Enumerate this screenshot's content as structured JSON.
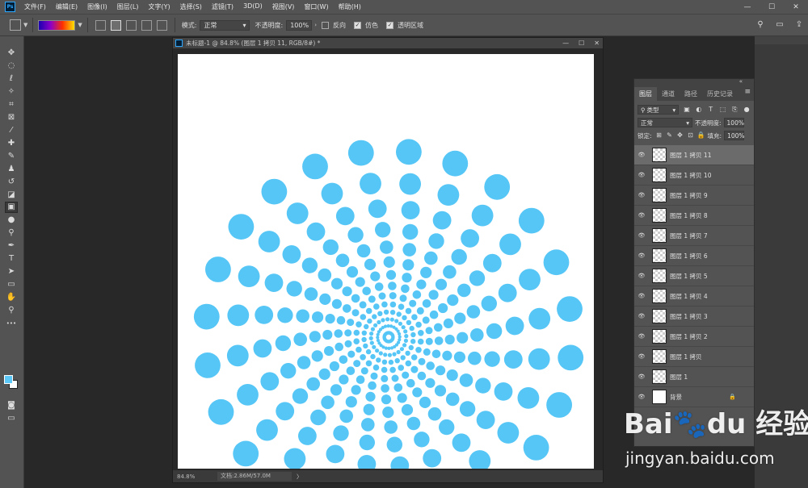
{
  "app": {
    "logo_text": "Ps",
    "menu": [
      "文件(F)",
      "编辑(E)",
      "图像(I)",
      "图层(L)",
      "文字(Y)",
      "选择(S)",
      "滤镜(T)",
      "3D(D)",
      "视图(V)",
      "窗口(W)",
      "帮助(H)"
    ],
    "window_controls": [
      "—",
      "☐",
      "✕"
    ]
  },
  "options_bar": {
    "mode_label": "模式:",
    "mode_value": "正常",
    "opacity_label": "不透明度:",
    "opacity_value": "100%",
    "reverse_label": "反向",
    "dither_label": "仿色",
    "transparency_label": "透明区域",
    "reverse_checked": false,
    "dither_checked": true,
    "transparency_checked": true
  },
  "toolbar": {
    "tools": [
      {
        "name": "move-tool",
        "glyph": "✥"
      },
      {
        "name": "marquee-tool",
        "glyph": "◌"
      },
      {
        "name": "lasso-tool",
        "glyph": "ℓ"
      },
      {
        "name": "magic-wand-tool",
        "glyph": "✧"
      },
      {
        "name": "crop-tool",
        "glyph": "⌗"
      },
      {
        "name": "frame-tool",
        "glyph": "⊠"
      },
      {
        "name": "eyedropper-tool",
        "glyph": "⁄"
      },
      {
        "name": "healing-brush-tool",
        "glyph": "✚"
      },
      {
        "name": "brush-tool",
        "glyph": "✎"
      },
      {
        "name": "clone-stamp-tool",
        "glyph": "♟"
      },
      {
        "name": "history-brush-tool",
        "glyph": "↺"
      },
      {
        "name": "eraser-tool",
        "glyph": "◪"
      },
      {
        "name": "gradient-tool",
        "glyph": "▣"
      },
      {
        "name": "blur-tool",
        "glyph": "●"
      },
      {
        "name": "dodge-tool",
        "glyph": "⚲"
      },
      {
        "name": "pen-tool",
        "glyph": "✒"
      },
      {
        "name": "type-tool",
        "glyph": "T"
      },
      {
        "name": "path-selection-tool",
        "glyph": "➤"
      },
      {
        "name": "rectangle-tool",
        "glyph": "▭"
      },
      {
        "name": "hand-tool",
        "glyph": "✋"
      },
      {
        "name": "zoom-tool",
        "glyph": "⚲"
      },
      {
        "name": "more-tools",
        "glyph": "•••"
      }
    ],
    "active_tool": "gradient-tool",
    "foreground_color": "#5bc8f8",
    "background_color": "#ffffff"
  },
  "document": {
    "title": "未标题-1 @ 84.8% (图层 1 拷贝 11, RGB/8#) *",
    "zoom": "84.8%",
    "doc_info": "文档:2.86M/57.0M",
    "arrow": "〉",
    "dot_color": "#55c6f6"
  },
  "layers_panel": {
    "tabs": [
      "图层",
      "通道",
      "路径",
      "历史记录"
    ],
    "filter_label": "类型",
    "blend_mode": "正常",
    "opacity_label": "不透明度:",
    "opacity_value": "100%",
    "lock_label": "锁定:",
    "fill_label": "填充:",
    "fill_value": "100%",
    "layers": [
      {
        "name": "图层 1 拷贝 11",
        "selected": true,
        "transparent": true
      },
      {
        "name": "图层 1 拷贝 10",
        "selected": false,
        "transparent": true
      },
      {
        "name": "图层 1 拷贝 9",
        "selected": false,
        "transparent": true
      },
      {
        "name": "图层 1 拷贝 8",
        "selected": false,
        "transparent": true
      },
      {
        "name": "图层 1 拷贝 7",
        "selected": false,
        "transparent": true
      },
      {
        "name": "图层 1 拷贝 6",
        "selected": false,
        "transparent": true
      },
      {
        "name": "图层 1 拷贝 5",
        "selected": false,
        "transparent": true
      },
      {
        "name": "图层 1 拷贝 4",
        "selected": false,
        "transparent": true
      },
      {
        "name": "图层 1 拷贝 3",
        "selected": false,
        "transparent": true
      },
      {
        "name": "图层 1 拷贝 2",
        "selected": false,
        "transparent": true
      },
      {
        "name": "图层 1 拷贝",
        "selected": false,
        "transparent": true
      },
      {
        "name": "图层 1",
        "selected": false,
        "transparent": true
      },
      {
        "name": "背景",
        "selected": false,
        "transparent": false,
        "locked": true
      }
    ]
  },
  "watermark": {
    "logo": "Bai🐾du 经验",
    "url": "jingyan.baidu.com"
  }
}
